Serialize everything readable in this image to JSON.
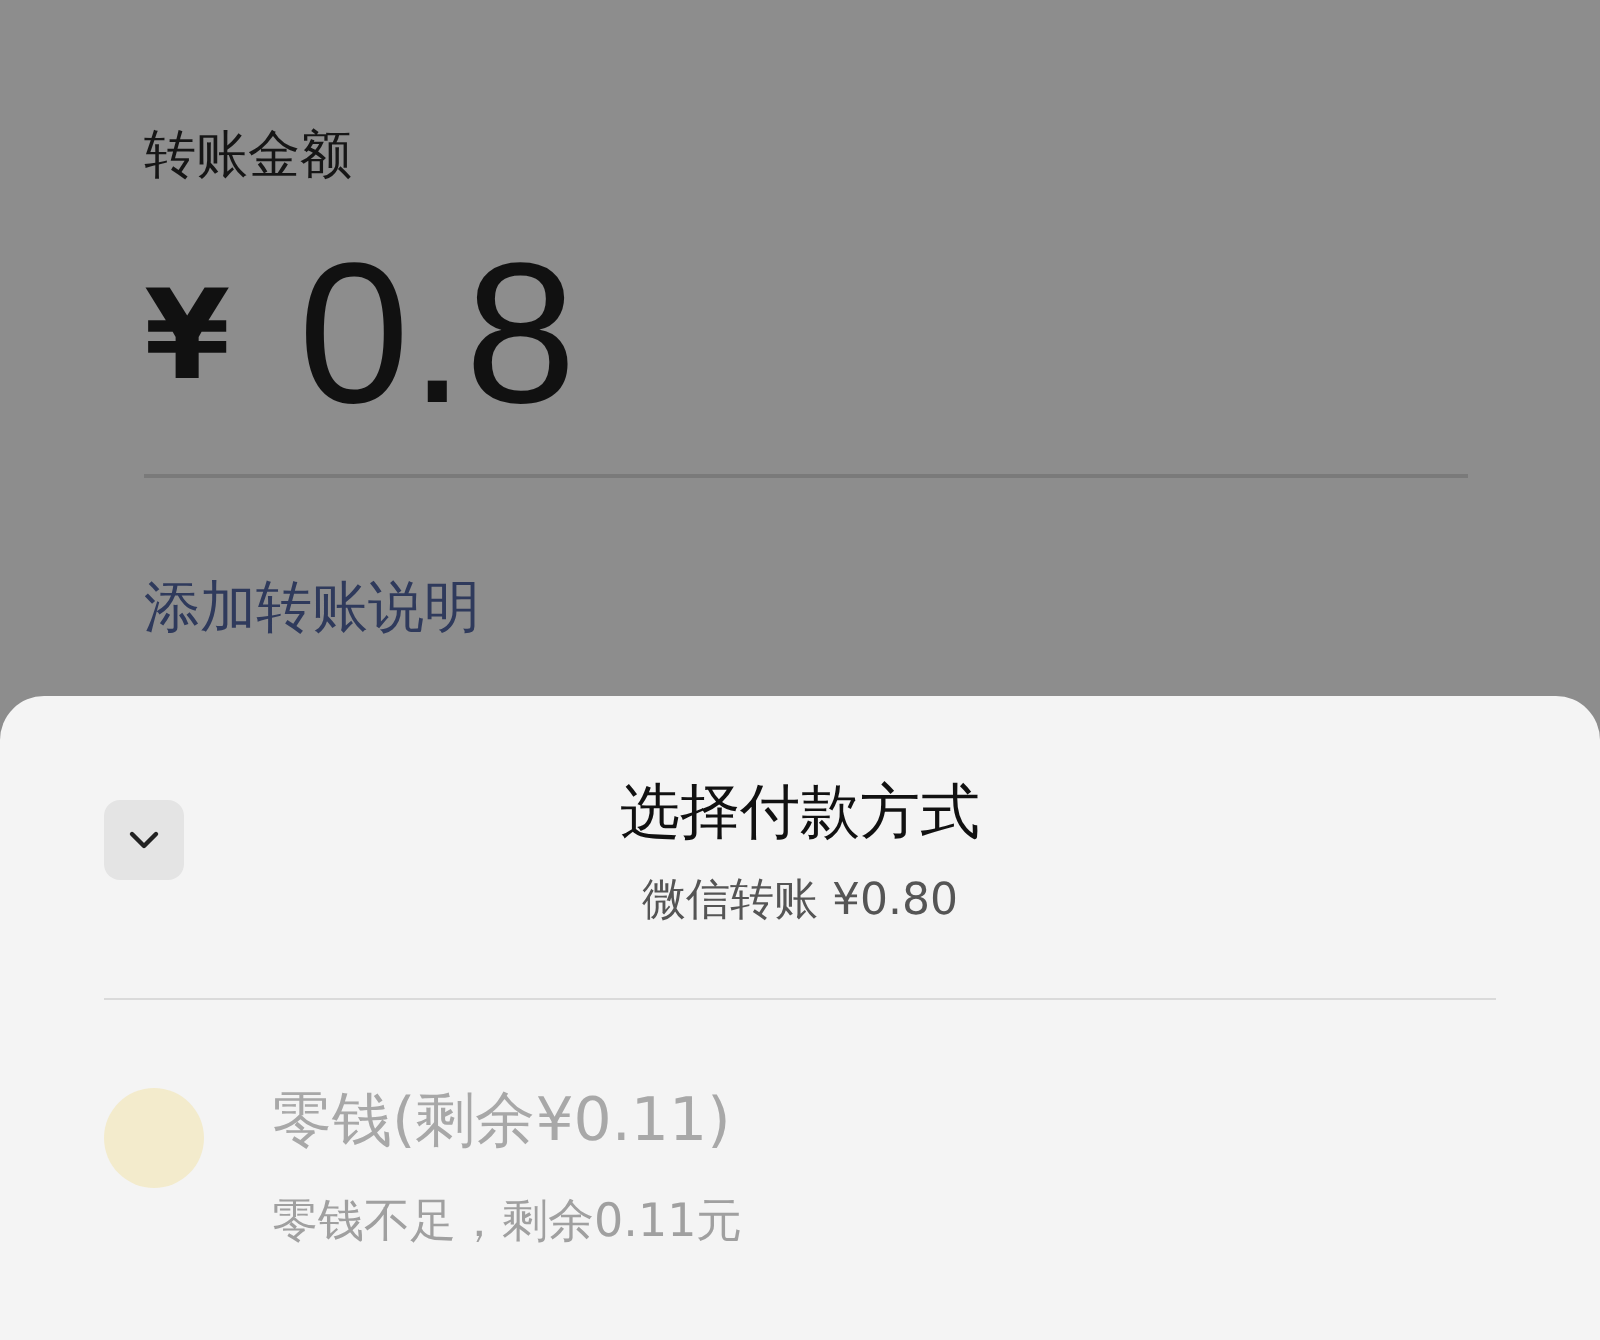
{
  "transfer": {
    "label": "转账金额",
    "currency": "¥",
    "amount": "0.8",
    "note_link": "添加转账说明"
  },
  "sheet": {
    "title": "选择付款方式",
    "subtitle": "微信转账 ¥0.80",
    "methods": [
      {
        "name": "零钱(剩余¥0.11)",
        "hint": "零钱不足，剩余0.11元",
        "disabled": true
      }
    ]
  }
}
